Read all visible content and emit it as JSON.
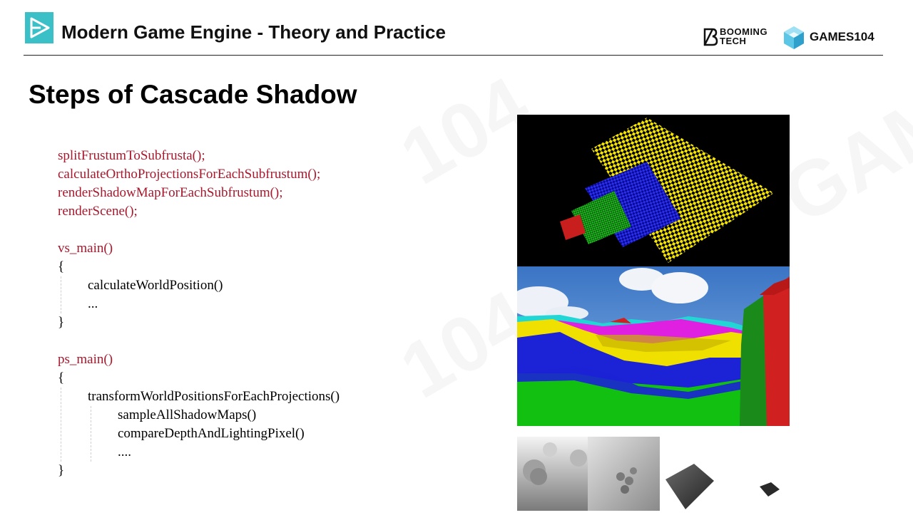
{
  "header": {
    "title": "Modern Game Engine - Theory and Practice",
    "brand_booming_line1": "BOOMING",
    "brand_booming_line2": "TECH",
    "brand_games": "GAMES104"
  },
  "slide": {
    "title": "Steps of Cascade Shadow"
  },
  "code": {
    "lines": [
      "splitFrustumToSubfrusta();",
      "calculateOrthoProjectionsForEachSubfrustum();",
      "renderShadowMapForEachSubfrustum();",
      "renderScene();",
      "vs_main()",
      "{",
      "calculateWorldPosition()",
      "...",
      "}",
      "ps_main()",
      "{",
      "transformWorldPositionsForEachProjections()",
      "sampleAllShadowMaps()",
      "compareDepthAndLightingPixel()",
      "....",
      "}"
    ]
  },
  "colors": {
    "accent_teal": "#3cc0c8",
    "code_red": "#a8182c",
    "cascade_red": "#d02424",
    "cascade_green": "#12b012",
    "cascade_blue": "#1c22d6",
    "cascade_yellow": "#f4e000",
    "cascade_magenta": "#e020e0",
    "cascade_cyan": "#20d8d8"
  },
  "images": [
    {
      "name": "checkerboard-cascade-visualization",
      "icon": "cascade-checkerboard"
    },
    {
      "name": "terrain-cascade-colored-view",
      "icon": "cascade-terrain"
    },
    {
      "name": "shadow-map-thumbnails",
      "icon": "shadow-maps"
    }
  ]
}
